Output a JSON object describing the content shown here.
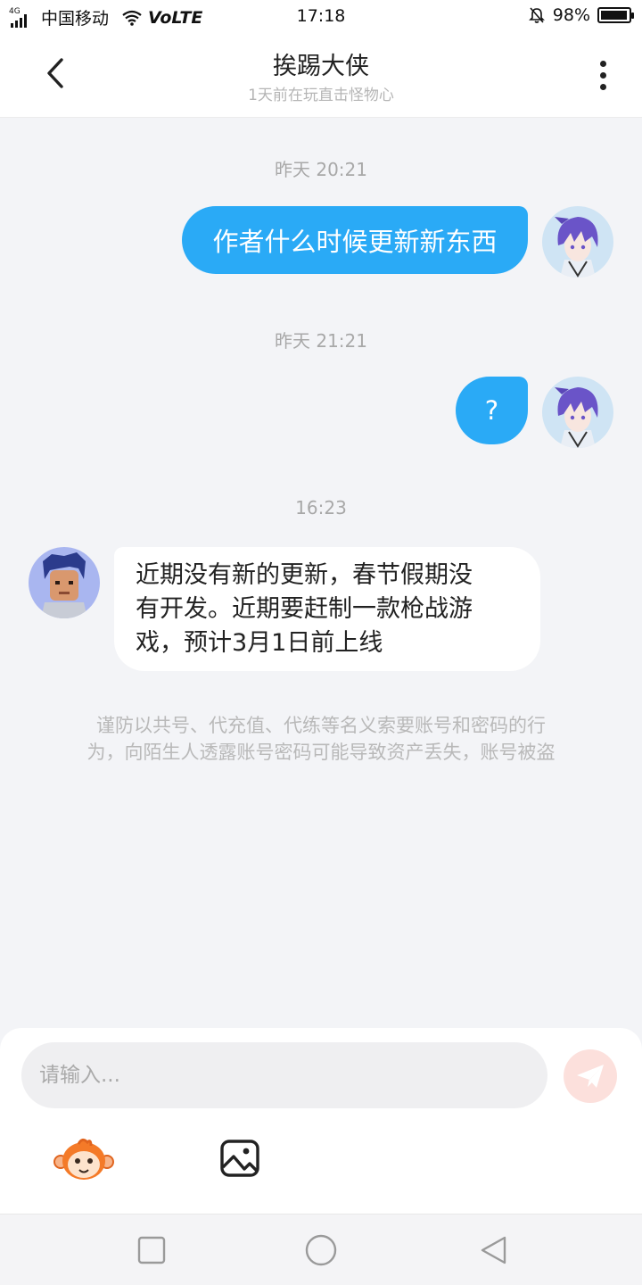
{
  "status_bar": {
    "network_badge": "4G",
    "carrier": "中国移动",
    "volte": "VoLTE",
    "time": "17:18",
    "battery_text": "98%",
    "battery_level": 0.98
  },
  "header": {
    "title": "挨踢大侠",
    "subtitle": "1天前在玩直击怪物心"
  },
  "messages": [
    {
      "timestamp": "昨天 20:21",
      "direction": "outgoing",
      "text": "作者什么时候更新新东西"
    },
    {
      "timestamp": "昨天 21:21",
      "direction": "outgoing",
      "text": "?"
    },
    {
      "timestamp": "16:23",
      "direction": "incoming",
      "lines": [
        "近期没有新的更新，春节假期没",
        "有开发。近期要赶制一款枪战游",
        "戏，预计3月1日前上线"
      ]
    }
  ],
  "notice": {
    "lines": [
      "谨防以共号、代充值、代练等名义索要账号和密码的行",
      "为，向陌生人透露账号密码可能导致资产丢失，账号被盗"
    ]
  },
  "composer": {
    "placeholder": "请输入...",
    "send_color": "#f7a89d"
  },
  "colors": {
    "accent": "#2aaaf6",
    "background": "#f3f4f7"
  },
  "icons": {
    "back": "chevron-left-icon",
    "more": "more-vertical-icon",
    "send": "paper-plane-icon",
    "emoji": "monkey-emoji-icon",
    "image": "image-icon",
    "nav": [
      "square-icon",
      "circle-icon",
      "triangle-back-icon"
    ]
  }
}
